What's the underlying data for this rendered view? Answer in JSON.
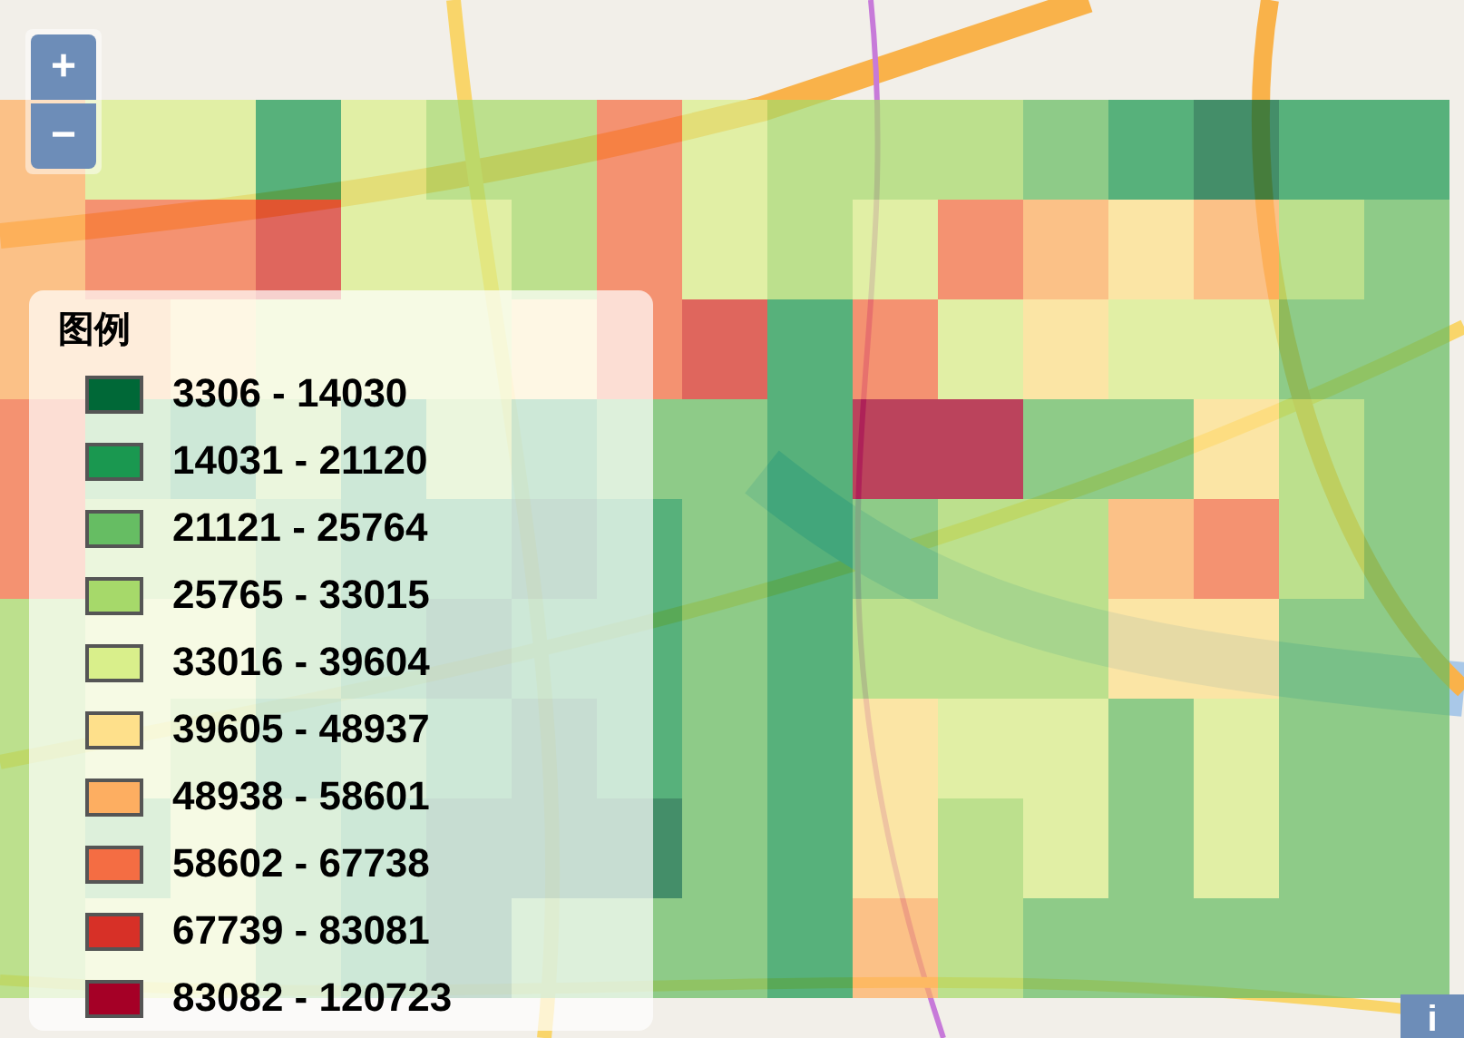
{
  "zoom_controls": {
    "zoom_in": "+",
    "zoom_out": "−"
  },
  "legend": {
    "title": "图例",
    "items": [
      {
        "label": "3306 - 14030",
        "color": "#006837"
      },
      {
        "label": "14031 - 21120",
        "color": "#1a9850"
      },
      {
        "label": "21121 - 25764",
        "color": "#66bd63"
      },
      {
        "label": "25765 - 33015",
        "color": "#a6d96a"
      },
      {
        "label": "33016 - 39604",
        "color": "#d9ef8b"
      },
      {
        "label": "39605 - 48937",
        "color": "#fee08b"
      },
      {
        "label": "48938 - 58601",
        "color": "#fdae61"
      },
      {
        "label": "58602 - 67738",
        "color": "#f46d43"
      },
      {
        "label": "67739 - 83081",
        "color": "#d73027"
      },
      {
        "label": "83082 - 120723",
        "color": "#a50026"
      }
    ]
  },
  "info_button": "i"
}
